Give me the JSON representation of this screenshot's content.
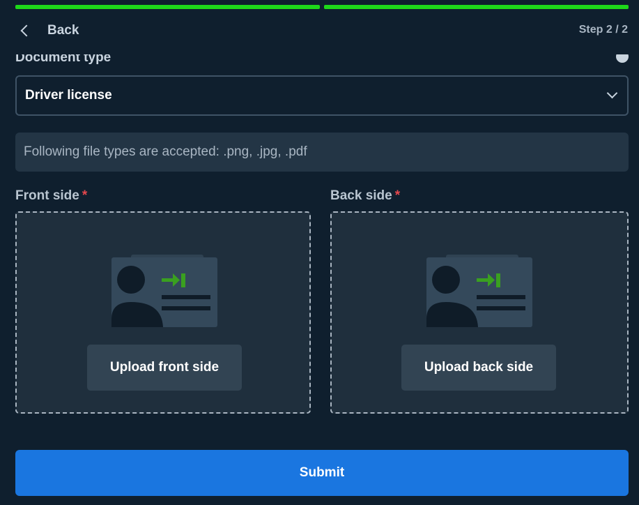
{
  "progress": {
    "steps_total": 2,
    "steps_completed": 2,
    "color": "#1ed81a"
  },
  "header": {
    "back_label": "Back",
    "step_text": "Step 2 / 2"
  },
  "document_type": {
    "label": "Document type",
    "selected": "Driver license"
  },
  "info_text": "Following file types are accepted: .png, .jpg, .pdf",
  "front": {
    "label": "Front side",
    "required_mark": "*",
    "button_label": "Upload front side",
    "icon": "id-card-upload-icon"
  },
  "back": {
    "label": "Back side",
    "required_mark": "*",
    "button_label": "Upload back side",
    "icon": "id-card-upload-icon"
  },
  "submit_label": "Submit",
  "colors": {
    "background": "#0f1f2e",
    "accent_blue": "#1a76e0",
    "required_red": "#e5484d",
    "arrow_green": "#3aa020"
  }
}
